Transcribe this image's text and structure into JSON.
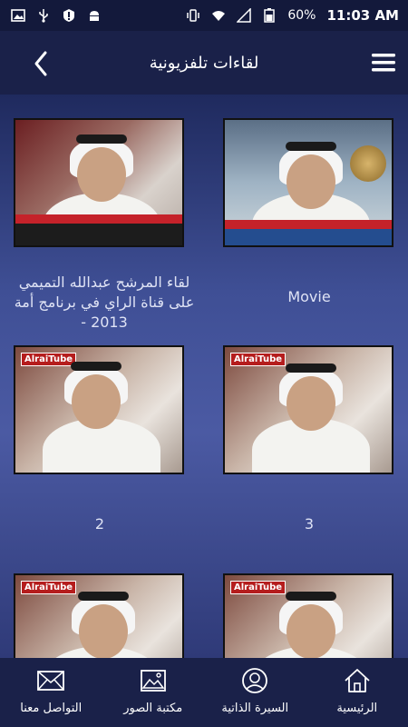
{
  "status_bar": {
    "battery": "60%",
    "time": "11:03 AM",
    "left_icons": [
      "image-icon",
      "usb-icon",
      "alert-icon",
      "android-icon"
    ],
    "right_icons": [
      "vibrate-icon",
      "wifi-icon",
      "signal-icon",
      "battery-icon"
    ]
  },
  "app_bar": {
    "title": "لقاءات تلفزيونية"
  },
  "grid": {
    "items": [
      {
        "caption": "Movie"
      },
      {
        "caption": "لقاء المرشح عبدالله التميمي على قناة الراي في برنامج أمة 2013 -"
      },
      {
        "caption": "3"
      },
      {
        "caption": "2"
      },
      {
        "caption": ""
      },
      {
        "caption": ""
      }
    ],
    "thumb_logo": "AlraiTube"
  },
  "bottom_nav": {
    "items": [
      {
        "label": "الرئيسية",
        "icon": "home-icon"
      },
      {
        "label": "السيرة الذاتية",
        "icon": "profile-icon"
      },
      {
        "label": "مكتبة الصور",
        "icon": "gallery-icon"
      },
      {
        "label": "التواصل معنا",
        "icon": "mail-icon"
      }
    ]
  },
  "colors": {
    "bar_bg": "#1a2149",
    "status_bg": "#13193b",
    "caption": "#dfe3f5"
  }
}
